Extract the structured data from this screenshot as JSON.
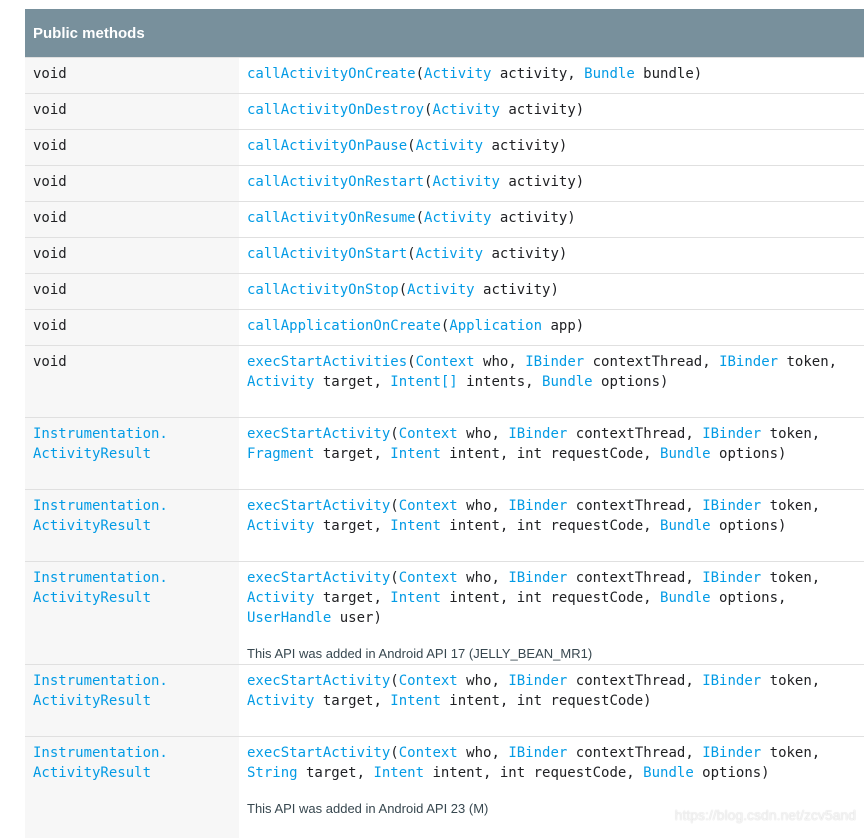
{
  "header": "Public methods",
  "rows": [
    {
      "type": [
        "void"
      ],
      "sig": [
        [
          "callActivityOnCreate",
          1
        ],
        [
          "(",
          0
        ],
        [
          "Activity",
          1
        ],
        [
          " activity, ",
          0
        ],
        [
          "Bundle",
          1
        ],
        [
          " bundle)",
          0
        ]
      ]
    },
    {
      "type": [
        "void"
      ],
      "sig": [
        [
          "callActivityOnDestroy",
          1
        ],
        [
          "(",
          0
        ],
        [
          "Activity",
          1
        ],
        [
          " activity)",
          0
        ]
      ]
    },
    {
      "type": [
        "void"
      ],
      "sig": [
        [
          "callActivityOnPause",
          1
        ],
        [
          "(",
          0
        ],
        [
          "Activity",
          1
        ],
        [
          " activity)",
          0
        ]
      ]
    },
    {
      "type": [
        "void"
      ],
      "sig": [
        [
          "callActivityOnRestart",
          1
        ],
        [
          "(",
          0
        ],
        [
          "Activity",
          1
        ],
        [
          " activity)",
          0
        ]
      ]
    },
    {
      "type": [
        "void"
      ],
      "sig": [
        [
          "callActivityOnResume",
          1
        ],
        [
          "(",
          0
        ],
        [
          "Activity",
          1
        ],
        [
          " activity)",
          0
        ]
      ]
    },
    {
      "type": [
        "void"
      ],
      "sig": [
        [
          "callActivityOnStart",
          1
        ],
        [
          "(",
          0
        ],
        [
          "Activity",
          1
        ],
        [
          " activity)",
          0
        ]
      ]
    },
    {
      "type": [
        "void"
      ],
      "sig": [
        [
          "callActivityOnStop",
          1
        ],
        [
          "(",
          0
        ],
        [
          "Activity",
          1
        ],
        [
          " activity)",
          0
        ]
      ]
    },
    {
      "type": [
        "void"
      ],
      "sig": [
        [
          "callApplicationOnCreate",
          1
        ],
        [
          "(",
          0
        ],
        [
          "Application",
          1
        ],
        [
          " app)",
          0
        ]
      ]
    },
    {
      "type": [
        "void"
      ],
      "sig": [
        [
          "execStartActivities",
          1
        ],
        [
          "(",
          0
        ],
        [
          "Context",
          1
        ],
        [
          " who, ",
          0
        ],
        [
          "IBinder",
          1
        ],
        [
          " contextThread, ",
          0
        ],
        [
          "IBinder",
          1
        ],
        [
          " token, ",
          0
        ],
        [
          "Activity",
          1
        ],
        [
          " target, ",
          0
        ],
        [
          "Intent[]",
          1
        ],
        [
          " intents, ",
          0
        ],
        [
          "Bundle",
          1
        ],
        [
          " options)",
          0
        ]
      ]
    },
    {
      "type": [
        "Instrumentation.",
        "ActivityResult"
      ],
      "sig": [
        [
          "execStartActivity",
          1
        ],
        [
          "(",
          0
        ],
        [
          "Context",
          1
        ],
        [
          " who, ",
          0
        ],
        [
          "IBinder",
          1
        ],
        [
          " contextThread, ",
          0
        ],
        [
          "IBinder",
          1
        ],
        [
          " token, ",
          0
        ],
        [
          "Fragment",
          1
        ],
        [
          " target, ",
          0
        ],
        [
          "Intent",
          1
        ],
        [
          " intent, int requestCode, ",
          0
        ],
        [
          "Bundle",
          1
        ],
        [
          " options)",
          0
        ]
      ]
    },
    {
      "type": [
        "Instrumentation.",
        "ActivityResult"
      ],
      "sig": [
        [
          "execStartActivity",
          1
        ],
        [
          "(",
          0
        ],
        [
          "Context",
          1
        ],
        [
          " who, ",
          0
        ],
        [
          "IBinder",
          1
        ],
        [
          " contextThread, ",
          0
        ],
        [
          "IBinder",
          1
        ],
        [
          " token, ",
          0
        ],
        [
          "Activity",
          1
        ],
        [
          " target, ",
          0
        ],
        [
          "Intent",
          1
        ],
        [
          " intent, int requestCode, ",
          0
        ],
        [
          "Bundle",
          1
        ],
        [
          " options)",
          0
        ]
      ]
    },
    {
      "type": [
        "Instrumentation.",
        "ActivityResult"
      ],
      "sig": [
        [
          "execStartActivity",
          1
        ],
        [
          "(",
          0
        ],
        [
          "Context",
          1
        ],
        [
          " who, ",
          0
        ],
        [
          "IBinder",
          1
        ],
        [
          " contextThread, ",
          0
        ],
        [
          "IBinder",
          1
        ],
        [
          " token, ",
          0
        ],
        [
          "Activity",
          1
        ],
        [
          " target, ",
          0
        ],
        [
          "Intent",
          1
        ],
        [
          " intent, int requestCode, ",
          0
        ],
        [
          "Bundle",
          1
        ],
        [
          " options, ",
          0
        ],
        [
          "UserHandle",
          1
        ],
        [
          " user)",
          0
        ]
      ],
      "note": "This API was added in Android API 17 (JELLY_BEAN_MR1)"
    },
    {
      "type": [
        "Instrumentation.",
        "ActivityResult"
      ],
      "sig": [
        [
          "execStartActivity",
          1
        ],
        [
          "(",
          0
        ],
        [
          "Context",
          1
        ],
        [
          " who, ",
          0
        ],
        [
          "IBinder",
          1
        ],
        [
          " contextThread, ",
          0
        ],
        [
          "IBinder",
          1
        ],
        [
          " token, ",
          0
        ],
        [
          "Activity",
          1
        ],
        [
          " target, ",
          0
        ],
        [
          "Intent",
          1
        ],
        [
          " intent, int requestCode)",
          0
        ]
      ]
    },
    {
      "type": [
        "Instrumentation.",
        "ActivityResult"
      ],
      "sig": [
        [
          "execStartActivity",
          1
        ],
        [
          "(",
          0
        ],
        [
          "Context",
          1
        ],
        [
          " who, ",
          0
        ],
        [
          "IBinder",
          1
        ],
        [
          " contextThread, ",
          0
        ],
        [
          "IBinder",
          1
        ],
        [
          " token, ",
          0
        ],
        [
          "String",
          1
        ],
        [
          " target, ",
          0
        ],
        [
          "Intent",
          1
        ],
        [
          " intent, int requestCode, ",
          0
        ],
        [
          "Bundle",
          1
        ],
        [
          " options)",
          0
        ]
      ],
      "note": "This API was added in Android API 23 (M)"
    }
  ],
  "watermark": "https://blog.csdn.net/zcv5and"
}
